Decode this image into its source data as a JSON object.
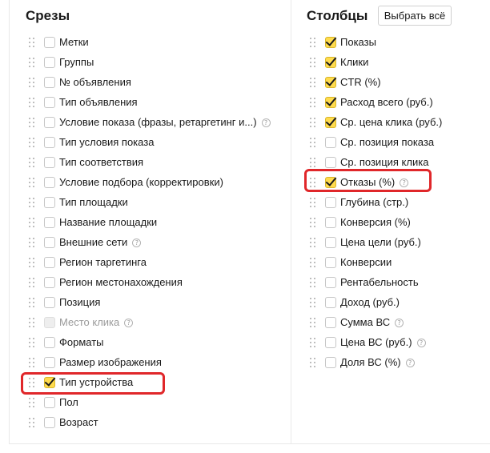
{
  "slices": {
    "title": "Срезы",
    "items": [
      {
        "label": "Метки",
        "checked": false,
        "disabled": false,
        "help": false
      },
      {
        "label": "Группы",
        "checked": false,
        "disabled": false,
        "help": false
      },
      {
        "label": "№ объявления",
        "checked": false,
        "disabled": false,
        "help": false
      },
      {
        "label": "Тип объявления",
        "checked": false,
        "disabled": false,
        "help": false
      },
      {
        "label": "Условие показа (фразы, ретаргетинг и...)",
        "checked": false,
        "disabled": false,
        "help": true
      },
      {
        "label": "Тип условия показа",
        "checked": false,
        "disabled": false,
        "help": false
      },
      {
        "label": "Тип соответствия",
        "checked": false,
        "disabled": false,
        "help": false
      },
      {
        "label": "Условие подбора (корректировки)",
        "checked": false,
        "disabled": false,
        "help": false
      },
      {
        "label": "Тип площадки",
        "checked": false,
        "disabled": false,
        "help": false
      },
      {
        "label": "Название площадки",
        "checked": false,
        "disabled": false,
        "help": false
      },
      {
        "label": "Внешние сети",
        "checked": false,
        "disabled": false,
        "help": true
      },
      {
        "label": "Регион таргетинга",
        "checked": false,
        "disabled": false,
        "help": false
      },
      {
        "label": "Регион местонахождения",
        "checked": false,
        "disabled": false,
        "help": false
      },
      {
        "label": "Позиция",
        "checked": false,
        "disabled": false,
        "help": false
      },
      {
        "label": "Место клика",
        "checked": false,
        "disabled": true,
        "help": true
      },
      {
        "label": "Форматы",
        "checked": false,
        "disabled": false,
        "help": false
      },
      {
        "label": "Размер изображения",
        "checked": false,
        "disabled": false,
        "help": false
      },
      {
        "label": "Тип устройства",
        "checked": true,
        "disabled": false,
        "help": false
      },
      {
        "label": "Пол",
        "checked": false,
        "disabled": false,
        "help": false
      },
      {
        "label": "Возраст",
        "checked": false,
        "disabled": false,
        "help": false
      }
    ]
  },
  "columns": {
    "title": "Столбцы",
    "select_all_label": "Выбрать всё",
    "items": [
      {
        "label": "Показы",
        "checked": true,
        "help": false
      },
      {
        "label": "Клики",
        "checked": true,
        "help": false
      },
      {
        "label": "CTR (%)",
        "checked": true,
        "help": false
      },
      {
        "label": "Расход всего (руб.)",
        "checked": true,
        "help": false
      },
      {
        "label": "Ср. цена клика (руб.)",
        "checked": true,
        "help": false
      },
      {
        "label": "Ср. позиция показа",
        "checked": false,
        "help": false
      },
      {
        "label": "Ср. позиция клика",
        "checked": false,
        "help": false
      },
      {
        "label": "Отказы (%)",
        "checked": true,
        "help": true
      },
      {
        "label": "Глубина (стр.)",
        "checked": false,
        "help": false
      },
      {
        "label": "Конверсия (%)",
        "checked": false,
        "help": false
      },
      {
        "label": "Цена цели (руб.)",
        "checked": false,
        "help": false
      },
      {
        "label": "Конверсии",
        "checked": false,
        "help": false
      },
      {
        "label": "Рентабельность",
        "checked": false,
        "help": false
      },
      {
        "label": "Доход (руб.)",
        "checked": false,
        "help": false
      },
      {
        "label": "Сумма ВС",
        "checked": false,
        "help": true
      },
      {
        "label": "Цена ВС (руб.)",
        "checked": false,
        "help": true
      },
      {
        "label": "Доля ВС (%)",
        "checked": false,
        "help": true
      }
    ]
  },
  "help_glyph": "?",
  "colors": {
    "checkbox_checked": "#ffdb4d",
    "highlight": "#e0272a"
  }
}
